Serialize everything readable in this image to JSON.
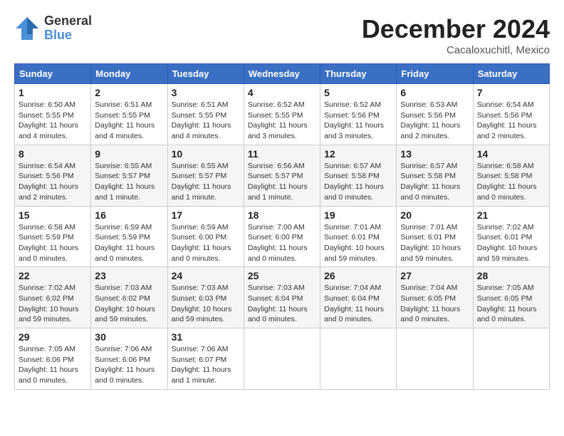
{
  "header": {
    "logo_general": "General",
    "logo_blue": "Blue",
    "month_title": "December 2024",
    "location": "Cacaloxuchitl, Mexico"
  },
  "days_of_week": [
    "Sunday",
    "Monday",
    "Tuesday",
    "Wednesday",
    "Thursday",
    "Friday",
    "Saturday"
  ],
  "weeks": [
    [
      {
        "day": "1",
        "info": "Sunrise: 6:50 AM\nSunset: 5:55 PM\nDaylight: 11 hours and 4 minutes."
      },
      {
        "day": "2",
        "info": "Sunrise: 6:51 AM\nSunset: 5:55 PM\nDaylight: 11 hours and 4 minutes."
      },
      {
        "day": "3",
        "info": "Sunrise: 6:51 AM\nSunset: 5:55 PM\nDaylight: 11 hours and 4 minutes."
      },
      {
        "day": "4",
        "info": "Sunrise: 6:52 AM\nSunset: 5:55 PM\nDaylight: 11 hours and 3 minutes."
      },
      {
        "day": "5",
        "info": "Sunrise: 6:52 AM\nSunset: 5:56 PM\nDaylight: 11 hours and 3 minutes."
      },
      {
        "day": "6",
        "info": "Sunrise: 6:53 AM\nSunset: 5:56 PM\nDaylight: 11 hours and 2 minutes."
      },
      {
        "day": "7",
        "info": "Sunrise: 6:54 AM\nSunset: 5:56 PM\nDaylight: 11 hours and 2 minutes."
      }
    ],
    [
      {
        "day": "8",
        "info": "Sunrise: 6:54 AM\nSunset: 5:56 PM\nDaylight: 11 hours and 2 minutes."
      },
      {
        "day": "9",
        "info": "Sunrise: 6:55 AM\nSunset: 5:57 PM\nDaylight: 11 hours and 1 minute."
      },
      {
        "day": "10",
        "info": "Sunrise: 6:55 AM\nSunset: 5:57 PM\nDaylight: 11 hours and 1 minute."
      },
      {
        "day": "11",
        "info": "Sunrise: 6:56 AM\nSunset: 5:57 PM\nDaylight: 11 hours and 1 minute."
      },
      {
        "day": "12",
        "info": "Sunrise: 6:57 AM\nSunset: 5:58 PM\nDaylight: 11 hours and 0 minutes."
      },
      {
        "day": "13",
        "info": "Sunrise: 6:57 AM\nSunset: 5:58 PM\nDaylight: 11 hours and 0 minutes."
      },
      {
        "day": "14",
        "info": "Sunrise: 6:58 AM\nSunset: 5:58 PM\nDaylight: 11 hours and 0 minutes."
      }
    ],
    [
      {
        "day": "15",
        "info": "Sunrise: 6:58 AM\nSunset: 5:59 PM\nDaylight: 11 hours and 0 minutes."
      },
      {
        "day": "16",
        "info": "Sunrise: 6:59 AM\nSunset: 5:59 PM\nDaylight: 11 hours and 0 minutes."
      },
      {
        "day": "17",
        "info": "Sunrise: 6:59 AM\nSunset: 6:00 PM\nDaylight: 11 hours and 0 minutes."
      },
      {
        "day": "18",
        "info": "Sunrise: 7:00 AM\nSunset: 6:00 PM\nDaylight: 11 hours and 0 minutes."
      },
      {
        "day": "19",
        "info": "Sunrise: 7:01 AM\nSunset: 6:01 PM\nDaylight: 10 hours and 59 minutes."
      },
      {
        "day": "20",
        "info": "Sunrise: 7:01 AM\nSunset: 6:01 PM\nDaylight: 10 hours and 59 minutes."
      },
      {
        "day": "21",
        "info": "Sunrise: 7:02 AM\nSunset: 6:01 PM\nDaylight: 10 hours and 59 minutes."
      }
    ],
    [
      {
        "day": "22",
        "info": "Sunrise: 7:02 AM\nSunset: 6:02 PM\nDaylight: 10 hours and 59 minutes."
      },
      {
        "day": "23",
        "info": "Sunrise: 7:03 AM\nSunset: 6:02 PM\nDaylight: 10 hours and 59 minutes."
      },
      {
        "day": "24",
        "info": "Sunrise: 7:03 AM\nSunset: 6:03 PM\nDaylight: 10 hours and 59 minutes."
      },
      {
        "day": "25",
        "info": "Sunrise: 7:03 AM\nSunset: 6:04 PM\nDaylight: 11 hours and 0 minutes."
      },
      {
        "day": "26",
        "info": "Sunrise: 7:04 AM\nSunset: 6:04 PM\nDaylight: 11 hours and 0 minutes."
      },
      {
        "day": "27",
        "info": "Sunrise: 7:04 AM\nSunset: 6:05 PM\nDaylight: 11 hours and 0 minutes."
      },
      {
        "day": "28",
        "info": "Sunrise: 7:05 AM\nSunset: 6:05 PM\nDaylight: 11 hours and 0 minutes."
      }
    ],
    [
      {
        "day": "29",
        "info": "Sunrise: 7:05 AM\nSunset: 6:06 PM\nDaylight: 11 hours and 0 minutes."
      },
      {
        "day": "30",
        "info": "Sunrise: 7:06 AM\nSunset: 6:06 PM\nDaylight: 11 hours and 0 minutes."
      },
      {
        "day": "31",
        "info": "Sunrise: 7:06 AM\nSunset: 6:07 PM\nDaylight: 11 hours and 1 minute."
      },
      {
        "day": "",
        "info": ""
      },
      {
        "day": "",
        "info": ""
      },
      {
        "day": "",
        "info": ""
      },
      {
        "day": "",
        "info": ""
      }
    ]
  ]
}
